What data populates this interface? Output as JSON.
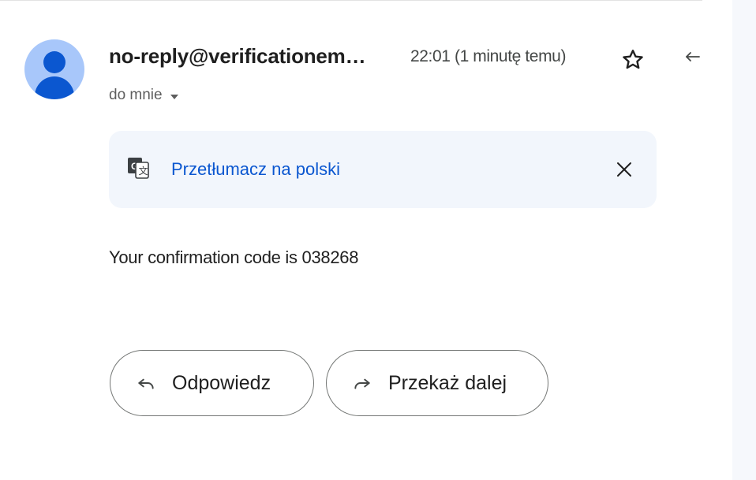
{
  "message": {
    "sender": "no-reply@verificationem…",
    "time": "22:01 (1 minutę temu)",
    "recipient_label": "do mnie",
    "body": "Your confirmation code is 038268"
  },
  "translate_bar": {
    "link_label": "Przetłumacz na polski"
  },
  "actions": {
    "reply_label": "Odpowiedz",
    "forward_label": "Przekaż dalej"
  },
  "icons": {
    "avatar": "person-avatar-icon",
    "star": "star-outline-icon",
    "reply_mini": "reply-arrow-icon",
    "translate": "google-translate-icon",
    "close": "close-icon",
    "reply": "reply-icon",
    "forward": "forward-icon",
    "caret": "chevron-down-icon"
  },
  "colors": {
    "link": "#0b57d0",
    "avatar_bg": "#a8c7fa",
    "avatar_fg": "#0b57d0",
    "translate_bar_bg": "#f2f6fc",
    "text": "#1f1f1f",
    "muted": "#444746"
  }
}
